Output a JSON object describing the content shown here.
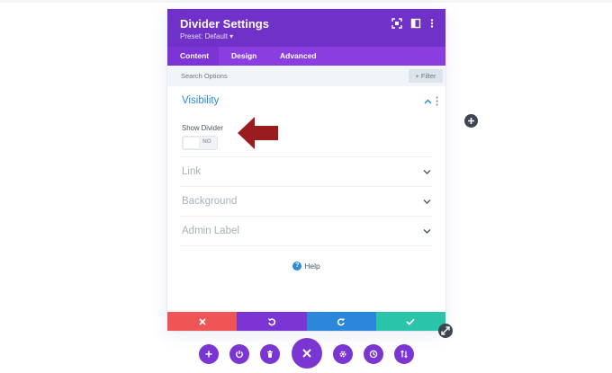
{
  "modal": {
    "title": "Divider Settings",
    "preset": "Preset: Default ▾",
    "tabs": [
      {
        "label": "Content",
        "active": true
      },
      {
        "label": "Design",
        "active": false
      },
      {
        "label": "Advanced",
        "active": false
      }
    ],
    "search": {
      "placeholder": "Search Options",
      "value": ""
    },
    "filter_label": "+ Filter",
    "sections": {
      "visibility": {
        "title": "Visibility",
        "expanded": true
      },
      "show_divider": {
        "label": "Show Divider",
        "state": "NO"
      },
      "link": {
        "title": "Link",
        "expanded": false
      },
      "background": {
        "title": "Background",
        "expanded": false
      },
      "admin_label": {
        "title": "Admin Label",
        "expanded": false
      }
    },
    "help": {
      "icon": "?",
      "label": "Help"
    },
    "footer": {
      "buttons": [
        {
          "name": "cancel",
          "icon": "close-icon",
          "color": "#ef5555"
        },
        {
          "name": "undo",
          "icon": "undo-icon",
          "color": "#7b35d3"
        },
        {
          "name": "redo",
          "icon": "redo-icon",
          "color": "#2b87da"
        },
        {
          "name": "save",
          "icon": "check-icon",
          "color": "#29c4a9"
        }
      ]
    }
  },
  "colors": {
    "header": "#7031c9",
    "tabs": "#8a3ee0",
    "accent_blue": "#2d8ad6",
    "arrow": "#9b1c1f",
    "bottom_buttons": "#7b35d3"
  },
  "bottom_toolbar": {
    "buttons": [
      "add-icon",
      "power-icon",
      "trash-icon",
      "close-icon",
      "gear-icon",
      "history-icon",
      "sort-icon"
    ]
  }
}
